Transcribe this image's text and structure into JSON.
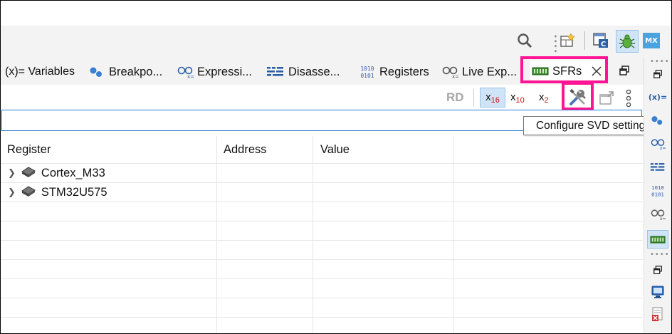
{
  "tabs": [
    {
      "label": "(x)= Variables",
      "icon": "variables-icon"
    },
    {
      "label": "Breakpo...",
      "icon": "breakpoints-icon"
    },
    {
      "label": "Expressi...",
      "icon": "expressions-icon"
    },
    {
      "label": "Disasse...",
      "icon": "disassembly-icon"
    },
    {
      "label": "Registers",
      "icon": "registers-icon"
    },
    {
      "label": "Live Exp...",
      "icon": "live-expressions-icon"
    },
    {
      "label": "SFRs",
      "icon": "sfrs-icon"
    }
  ],
  "viewbar": {
    "rd_label": "RD",
    "hex_label": "x",
    "hex_sub": "16",
    "dec_label": "x",
    "dec_sub": "10",
    "bin_label": "x",
    "bin_sub": "2"
  },
  "tooltip": "Configure SVD settings",
  "table": {
    "columns": [
      "Register",
      "Address",
      "Value"
    ],
    "rows": [
      {
        "name": "Cortex_M33",
        "address": "",
        "value": ""
      },
      {
        "name": "STM32U575",
        "address": "",
        "value": ""
      }
    ]
  },
  "topbar": {
    "mx_label": "MX"
  },
  "colors": {
    "highlight": "#ff1493",
    "accent": "#2b7bd9"
  }
}
